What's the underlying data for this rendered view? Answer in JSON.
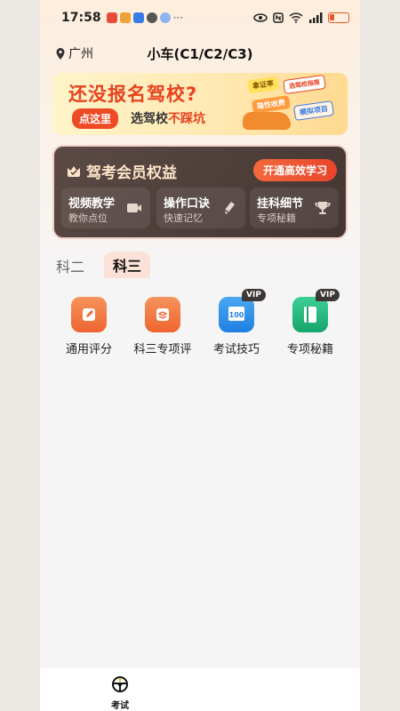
{
  "status_bar": {
    "time": "17:58"
  },
  "header": {
    "location": "广州",
    "car_type": "小车(C1/C2/C3)"
  },
  "banner": {
    "title": "还没报名驾校?",
    "button": "点这里",
    "subtitle_prefix": "选驾校",
    "subtitle_accent": "不踩坑",
    "tags": [
      "拿证率",
      "选驾校指南",
      "隐性收费",
      "模拟项目"
    ]
  },
  "vip": {
    "title": "驾考会员权益",
    "open_button": "开通高效学习",
    "features": [
      {
        "title": "视频教学",
        "subtitle": "教你点位",
        "icon": "video-icon"
      },
      {
        "title": "操作口诀",
        "subtitle": "快速记忆",
        "icon": "pen-icon"
      },
      {
        "title": "挂科细节",
        "subtitle": "专项秘籍",
        "icon": "trophy-icon"
      }
    ]
  },
  "subject_tabs": [
    {
      "label": "科二",
      "active": false
    },
    {
      "label": "科三",
      "active": true
    }
  ],
  "grid_items": [
    {
      "label": "通用评分",
      "color": "#f2783f",
      "vip": false,
      "icon": "edit-doc-icon"
    },
    {
      "label": "科三专项评",
      "color": "#f2783f",
      "vip": false,
      "icon": "layers-icon"
    },
    {
      "label": "考试技巧",
      "color": "#2e8fe8",
      "vip": true,
      "vip_text": "VIP",
      "icon": "score-book-icon"
    },
    {
      "label": "专项秘籍",
      "color": "#22b37a",
      "vip": true,
      "vip_text": "VIP",
      "icon": "notebook-icon"
    }
  ],
  "bottom_nav": {
    "label": "考试",
    "icon": "steering-wheel-icon"
  },
  "colors": {
    "accent": "#e8421f",
    "vip_bg": "#4a3b37"
  }
}
